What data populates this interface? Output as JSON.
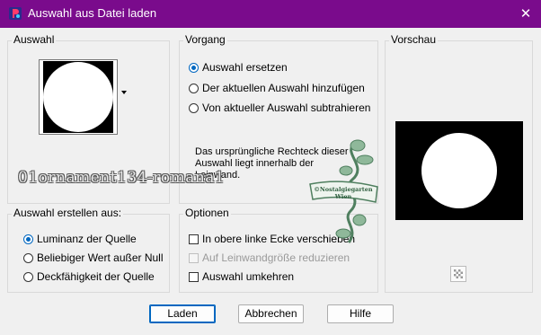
{
  "window": {
    "title": "Auswahl aus Datei laden",
    "close_glyph": "✕",
    "accent": "#7a0b8c"
  },
  "auswahl": {
    "label": "Auswahl"
  },
  "vorgang": {
    "label": "Vorgang",
    "options": [
      {
        "label": "Auswahl ersetzen",
        "selected": true
      },
      {
        "label": "Der aktuellen Auswahl hinzufügen",
        "selected": false
      },
      {
        "label": "Von aktueller Auswahl subtrahieren",
        "selected": false
      }
    ],
    "info": "Das ursprüngliche Rechteck dieser Auswahl liegt innerhalb der Leinwand."
  },
  "vorschau": {
    "label": "Vorschau"
  },
  "erstellen": {
    "label": "Auswahl erstellen aus:",
    "options": [
      {
        "label": "Luminanz der Quelle",
        "selected": true
      },
      {
        "label": "Beliebiger Wert außer Null",
        "selected": false
      },
      {
        "label": "Deckfähigkeit der Quelle",
        "selected": false
      }
    ]
  },
  "optionen": {
    "label": "Optionen",
    "items": [
      {
        "label": "In obere linke Ecke verschieben",
        "checked": false,
        "enabled": true
      },
      {
        "label": "Auf Leinwandgröße reduzieren",
        "checked": false,
        "enabled": false
      },
      {
        "label": "Auswahl umkehren",
        "checked": false,
        "enabled": true
      }
    ]
  },
  "buttons": {
    "load": "Laden",
    "cancel": "Abbrechen",
    "help": "Hilfe"
  },
  "overlay": {
    "watermark_text": "01ornament134-romana1",
    "stamp_text": [
      "©Nostalgiegarten",
      "Wien"
    ]
  }
}
